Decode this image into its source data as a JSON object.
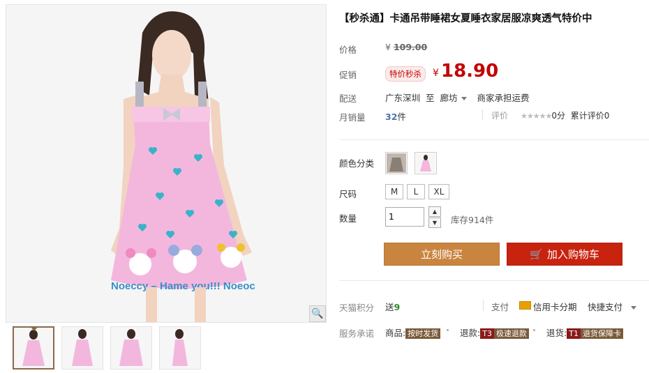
{
  "product": {
    "title": "【秒杀通】卡通吊带睡裙女夏睡衣家居服凉爽透气特价中"
  },
  "price": {
    "label": "价格",
    "currency": "¥",
    "original": "109.00"
  },
  "promo": {
    "label": "促销",
    "tag": "特价秒杀",
    "currency": "¥",
    "price": "18.90"
  },
  "shipping": {
    "label": "配送",
    "from": "广东深圳",
    "to_word": "至",
    "destination": "廊坊",
    "fee": "商家承担运费"
  },
  "sales": {
    "label": "月销量",
    "count": "32",
    "unit": "件",
    "rating_label": "评价",
    "stars": "★★★★★",
    "score": "0分",
    "reviews": "累计评价0"
  },
  "options": {
    "color_label": "颜色分类",
    "size_label": "尺码",
    "sizes": [
      "M",
      "L",
      "XL"
    ],
    "qty_label": "数量",
    "qty_value": "1",
    "stock": "库存914件"
  },
  "actions": {
    "buy_now": "立刻购买",
    "add_cart": "加入购物车"
  },
  "points": {
    "label": "天猫积分",
    "prefix": "送",
    "value": "9",
    "pay_label": "支付",
    "card": "信用卡分期",
    "quick": "快捷支付"
  },
  "service": {
    "label": "服务承诺",
    "items": [
      {
        "prefix": "商品:",
        "tag": "按时发货"
      },
      {
        "prefix": "退款:",
        "tag": "T3",
        "tag2": "极速退款"
      },
      {
        "prefix": "退货:",
        "tag": "T1",
        "tag2": "退货保障卡"
      }
    ]
  },
  "gallery": {
    "main_print": "Noeccy – Hame you!!! Noeoc"
  },
  "colors": {
    "accent_red": "#c40000",
    "buy_button": "#c9853f",
    "cart_button": "#c8230f"
  }
}
